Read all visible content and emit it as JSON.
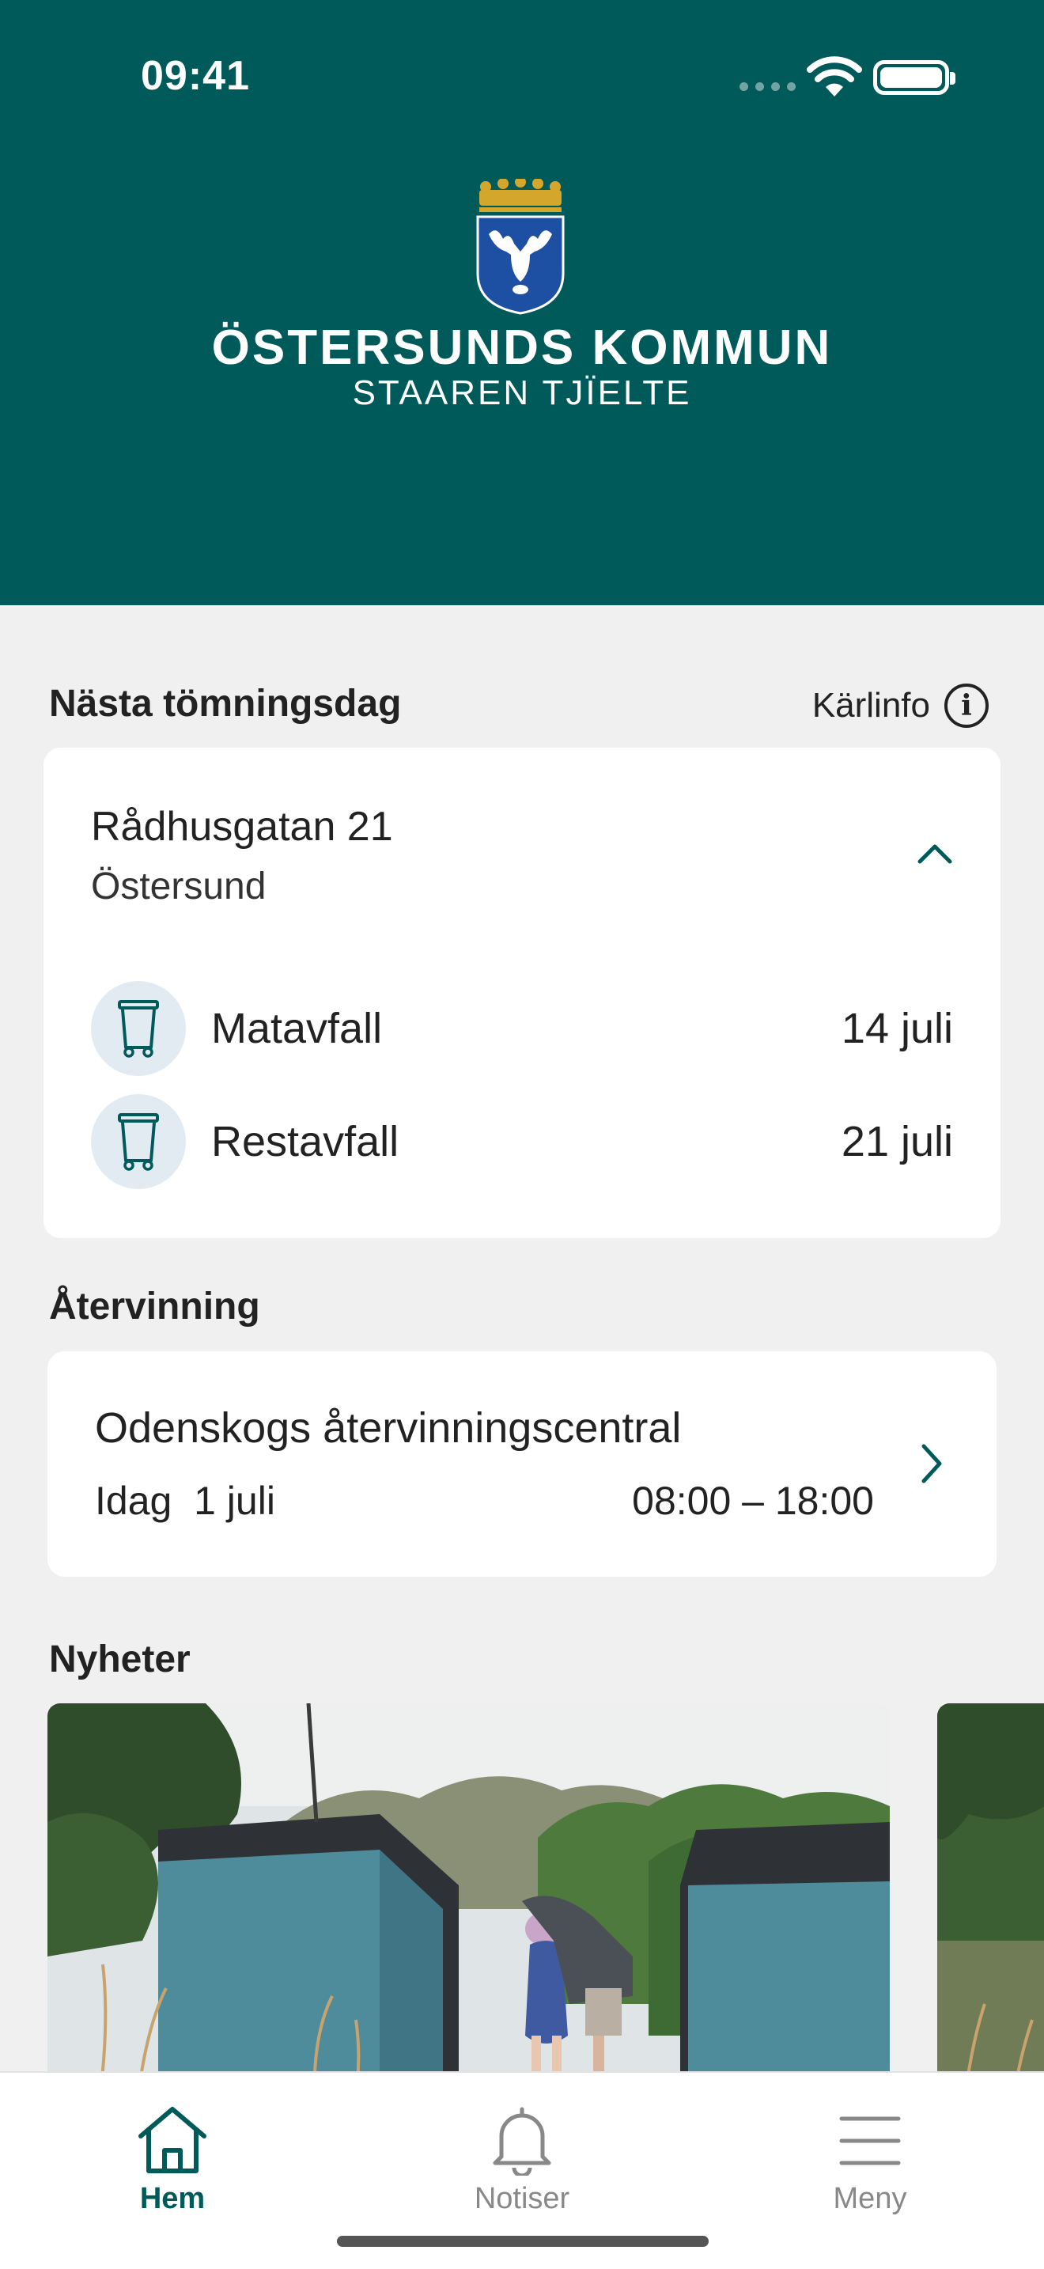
{
  "status_bar": {
    "time": "09:41"
  },
  "header": {
    "title": "ÖSTERSUNDS KOMMUN",
    "subtitle": "STAAREN TJÏELTE",
    "brand_color": "#005a5a"
  },
  "collection": {
    "section_title": "Nästa tömningsdag",
    "info_link": "Kärlinfo",
    "address_street": "Rådhusgatan 21",
    "address_city": "Östersund",
    "bins": [
      {
        "label": "Matavfall",
        "date": "14 juli",
        "icon": "bin-icon"
      },
      {
        "label": "Restavfall",
        "date": "21 juli",
        "icon": "bin-icon"
      }
    ]
  },
  "recycling": {
    "section_title": "Återvinning",
    "central_name": "Odenskogs återvinningscentral",
    "day": "Idag  1 juli",
    "hours": "08:00 – 18:00"
  },
  "news": {
    "section_title": "Nyheter"
  },
  "tabbar": {
    "tabs": [
      {
        "label": "Hem",
        "icon": "home-icon",
        "active": true
      },
      {
        "label": "Notiser",
        "icon": "bell-icon",
        "active": false
      },
      {
        "label": "Meny",
        "icon": "menu-icon",
        "active": false
      }
    ]
  }
}
